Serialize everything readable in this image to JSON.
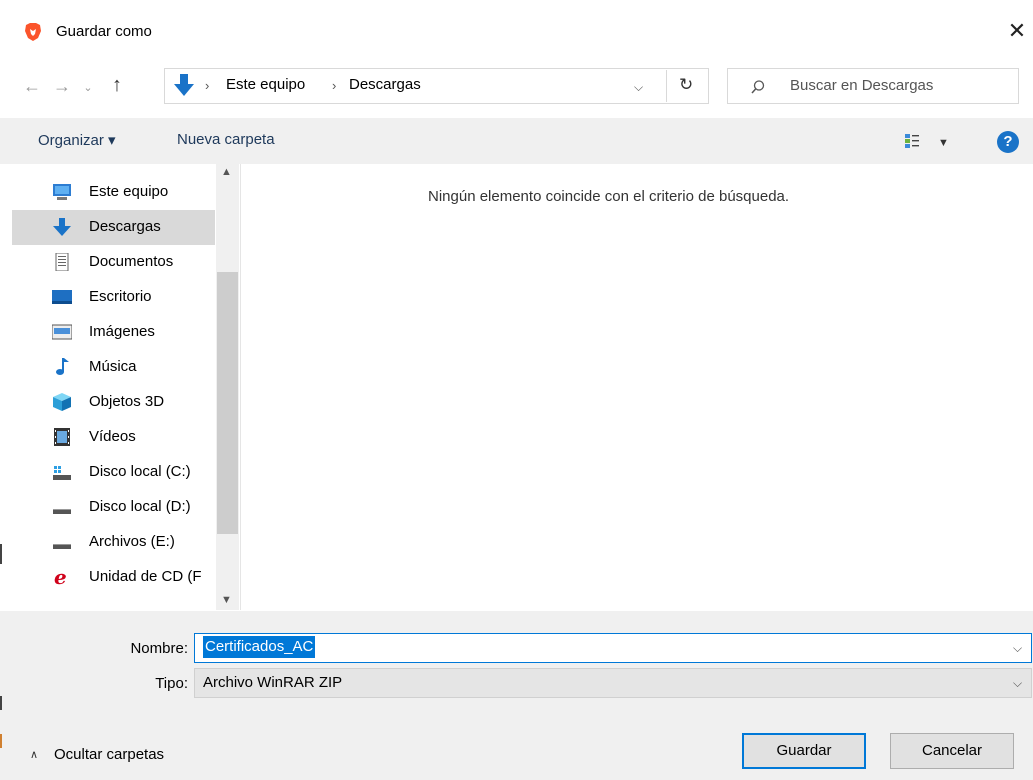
{
  "window": {
    "title": "Guardar como",
    "close_glyph": "✕"
  },
  "address": {
    "crumbs": [
      "Este equipo",
      "Descargas"
    ],
    "refresh_glyph": "↻"
  },
  "search": {
    "placeholder": "Buscar en Descargas"
  },
  "toolbar": {
    "organize": "Organizar ▾",
    "new_folder": "Nueva carpeta",
    "help": "?"
  },
  "nav": {
    "items": [
      {
        "label": "Este equipo",
        "icon": "computer-icon"
      },
      {
        "label": "Descargas",
        "icon": "download-arrow-icon",
        "selected": true
      },
      {
        "label": "Documentos",
        "icon": "document-icon"
      },
      {
        "label": "Escritorio",
        "icon": "desktop-icon"
      },
      {
        "label": "Imágenes",
        "icon": "pictures-icon"
      },
      {
        "label": "Música",
        "icon": "music-note-icon"
      },
      {
        "label": "Objetos 3D",
        "icon": "cube-3d-icon"
      },
      {
        "label": "Vídeos",
        "icon": "video-icon"
      },
      {
        "label": "Disco local (C:)",
        "icon": "system-drive-icon"
      },
      {
        "label": "Disco local (D:)",
        "icon": "drive-icon"
      },
      {
        "label": "Archivos (E:)",
        "icon": "drive-icon"
      },
      {
        "label": "Unidad de CD (F",
        "icon": "cd-drive-icon"
      }
    ]
  },
  "content": {
    "empty_message": "Ningún elemento coincide con el criterio de búsqueda."
  },
  "form": {
    "name_label": "Nombre:",
    "name_value": "Certificados_AC",
    "type_label": "Tipo:",
    "type_value": "Archivo WinRAR ZIP"
  },
  "footer": {
    "hide_folders": "Ocultar carpetas",
    "save": "Guardar",
    "cancel": "Cancelar"
  },
  "colors": {
    "accent": "#0078d7",
    "selection": "#d9d9d9",
    "toolbar_bg": "#f0f0f0"
  }
}
